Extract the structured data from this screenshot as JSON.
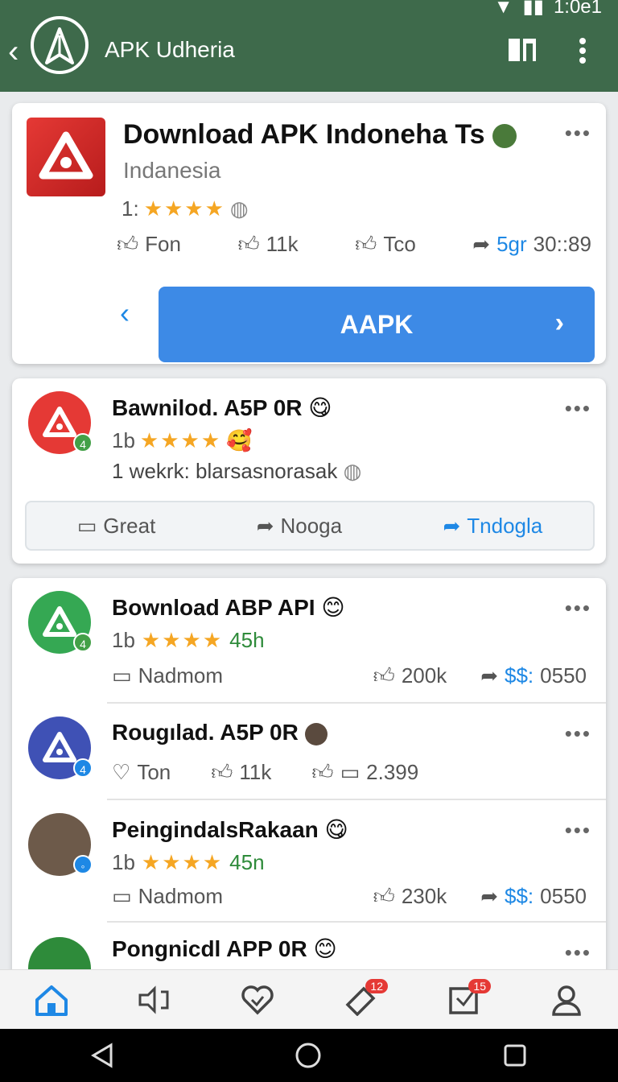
{
  "status": {
    "time": "1:0e1"
  },
  "appbar": {
    "title": "APK Udheria",
    "icons": [
      "back-icon",
      "logo-icon",
      "book-icon",
      "more-vert-icon"
    ]
  },
  "card1": {
    "title": "Download APK Indoneha Ts",
    "subtitle": "Indanesia",
    "rating_prefix": "1:",
    "stars": "★★★★",
    "actions": [
      {
        "icon": "thumb-icon",
        "label": "Fon"
      },
      {
        "icon": "like-icon",
        "label": "11k"
      },
      {
        "icon": "like-icon",
        "label": "Tco"
      },
      {
        "icon": "share-icon",
        "label": "5gr",
        "extra": "30::89"
      }
    ],
    "cta_label": "AAPK"
  },
  "card2": {
    "title": "Bawnilod. A5P 0R",
    "rating_prefix": "1b",
    "stars": "★★★★",
    "subtitle": "1 wekrk: blarsasnorasak",
    "badge": "4",
    "pills": [
      {
        "icon": "comment-icon",
        "label": "Great"
      },
      {
        "icon": "share-icon",
        "label": "Nooga"
      },
      {
        "icon": "share-icon",
        "label": "Tndogla"
      }
    ]
  },
  "list": [
    {
      "title": "Bownload ABP API",
      "rating_prefix": "1b",
      "stars": "★★★★",
      "extra": "45h",
      "left": "Nadmom",
      "likes": "200k",
      "price": "$$:",
      "price_val": "0550",
      "badge": "4",
      "color": "#35a853"
    },
    {
      "title": "Rougılad. A5P 0R",
      "left": "Ton",
      "likes": "11k",
      "extra": "2.399",
      "badge": "4",
      "color": "#3f51b5"
    },
    {
      "title": "PeingindalsRakaan",
      "rating_prefix": "1b",
      "stars": "★★★★",
      "extra": "45n",
      "left": "Nadmom",
      "likes": "230k",
      "price": "$$:",
      "price_val": "0550"
    },
    {
      "title": "Pongnicdl APP 0R",
      "color": "#2e8b3a"
    }
  ],
  "bottomnav": {
    "badges": [
      "12",
      "15"
    ]
  },
  "colors": {
    "appbar": "#3e6a4b",
    "accent": "#1e88e5",
    "star": "#f5a623"
  }
}
